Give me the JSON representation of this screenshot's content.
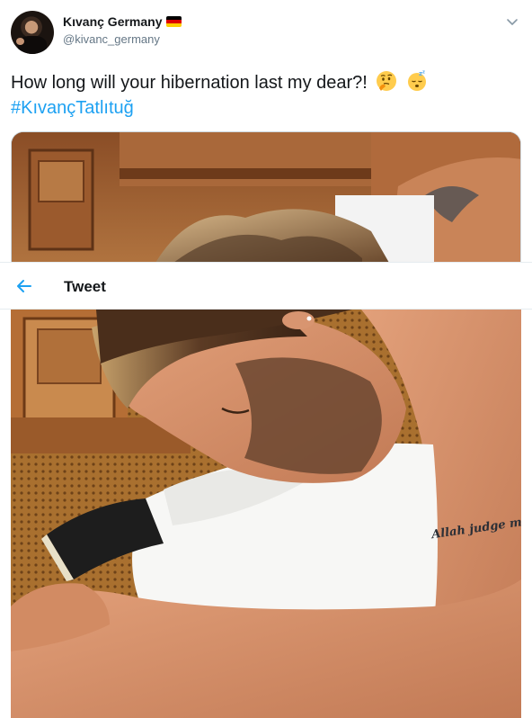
{
  "author": {
    "display_name": "Kıvanç Germany",
    "handle": "@kivanc_germany",
    "flag": "germany-flag"
  },
  "tweet": {
    "text": "How long will your hibernation last my dear?!",
    "emojis": [
      "thinking-face",
      "sleeping-face"
    ],
    "hashtag": "#KıvançTatlıtuğ"
  },
  "top_bar": {
    "title": "Tweet",
    "back_icon": "back-arrow-icon"
  },
  "image_text": {
    "tattoo": "Allah judge me!!!"
  },
  "colors": {
    "link": "#1da1f2",
    "text": "#14171a",
    "secondary": "#657786",
    "border": "#e6ecf0"
  }
}
